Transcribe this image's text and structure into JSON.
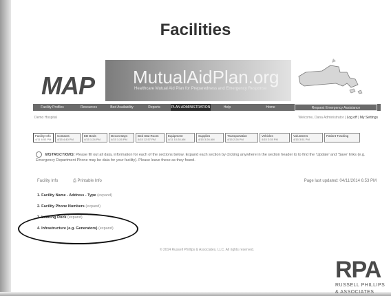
{
  "slide": {
    "title": "Facilities"
  },
  "banner": {
    "logo": "MAP",
    "site_name": "MutualAidPlan.org",
    "tagline": "Healthcare Mutual Aid Plan for Preparedness and Emergency Response"
  },
  "nav": {
    "items": [
      {
        "label": "Facility Profiles"
      },
      {
        "label": "Resources"
      },
      {
        "label": "Bed Availability"
      },
      {
        "label": "Reports"
      },
      {
        "label": "PLAN ADMINISTRATION",
        "active": true
      },
      {
        "label": "Help"
      },
      {
        "label": "Home"
      },
      {
        "label": "Request Emergency Assistance"
      }
    ]
  },
  "util": {
    "left": "Demo Hospital",
    "right_prefix": "Welcome, Dana Administrator |",
    "logout": "Log off",
    "settings": "My Settings"
  },
  "tabs": [
    {
      "label": "Facility Info",
      "date": "4/11 6:53 PM",
      "active": true
    },
    {
      "label": "Contacts",
      "date": "4/15 4:40 PM"
    },
    {
      "label": "ED Beds",
      "date": "4/15 1:24 PM"
    },
    {
      "label": "Decon Bays",
      "date": "4/15 1:26 PM"
    },
    {
      "label": "Bed Stat Room",
      "date": "4/15 12:57 PM"
    },
    {
      "label": "Equipment",
      "date": "4/11 10:28 AM"
    },
    {
      "label": "Supplies",
      "date": "4/15 3:26 AM"
    },
    {
      "label": "Transportation",
      "date": "4/15 2:26 PM"
    },
    {
      "label": "Vehicles",
      "date": "4/15 2:35 PM"
    },
    {
      "label": "Volunteers",
      "date": "4/15 3:51 PM"
    },
    {
      "label": "Patient Tracking",
      "date": ""
    }
  ],
  "instructions": {
    "heading": "INSTRUCTIONS:",
    "text": "Please fill out all data, information for each of the sections below. Expand each section by clicking anywhere in the section header to to find the 'Update' and 'Save' links (e.g. Emergency Department Phone may be data for your facility). Please leave these as they found."
  },
  "info": {
    "left": "Facility Info",
    "print": "Printable Info",
    "updated": "Page last updated: 04/11/2014 6:53 PM"
  },
  "sections": [
    {
      "label": "1. Facility Name - Address - Type",
      "expand": "(expand)"
    },
    {
      "label": "2. Facility Phone Numbers",
      "expand": "(expand)"
    },
    {
      "label": "3. Loading Dock",
      "expand": "(expand)"
    },
    {
      "label": "4. Infrastructure (e.g. Generators)",
      "expand": "(expand)"
    }
  ],
  "footer": "© 2014 Russell Phillips & Associates, LLC. All rights reserved.",
  "rpa": {
    "logo": "RPA",
    "line1": "RUSSELL PHILLIPS",
    "line2": "& ASSOCIATES"
  }
}
